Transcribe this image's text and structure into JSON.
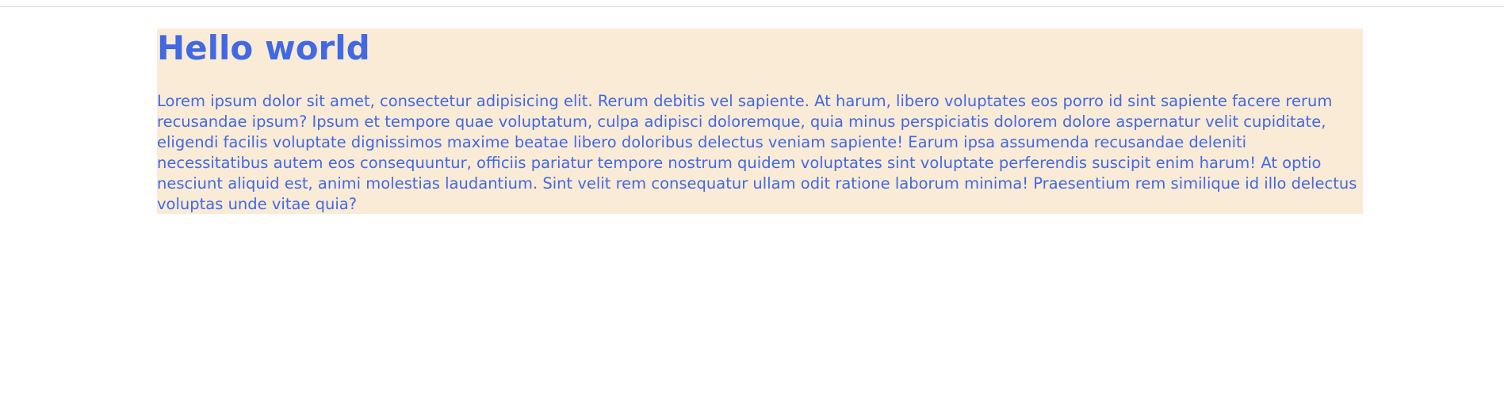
{
  "colors": {
    "background": "#ffffff",
    "content_background": "#faebd7",
    "text": "#4169e1",
    "divider": "#dddde2"
  },
  "main": {
    "heading": "Hello world",
    "paragraph": "Lorem ipsum dolor sit amet, consectetur adipisicing elit. Rerum debitis vel sapiente. At harum, libero voluptates eos porro id sint sapiente facere rerum recusandae ipsum? Ipsum et tempore quae voluptatum, culpa adipisci doloremque, quia minus perspiciatis dolorem dolore aspernatur velit cupiditate, eligendi facilis voluptate dignissimos maxime beatae libero doloribus delectus veniam sapiente! Earum ipsa assumenda recusandae deleniti necessitatibus autem eos consequuntur, officiis pariatur tempore nostrum quidem voluptates sint voluptate perferendis suscipit enim harum! At optio nesciunt aliquid est, animi molestias laudantium. Sint velit rem consequatur ullam odit ratione laborum minima! Praesentium rem similique id illo delectus voluptas unde vitae quia?"
  }
}
